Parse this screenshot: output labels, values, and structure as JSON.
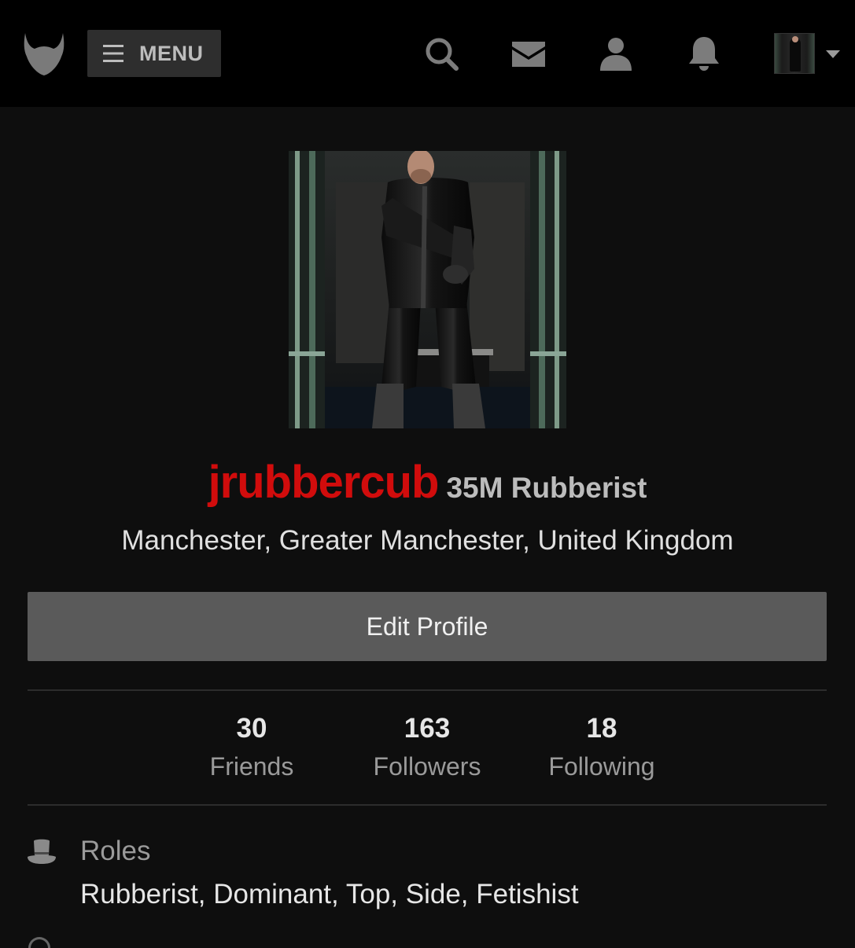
{
  "header": {
    "logo_icon": "devil-head-logo-icon",
    "menu_label": "MENU",
    "menu_icon": "hamburger-icon",
    "nav_icons": [
      "search-icon",
      "mail-icon",
      "user-icon",
      "bell-icon"
    ],
    "account_icon": "caret-down-icon"
  },
  "profile": {
    "username": "jrubbercub",
    "subtitle": "35M Rubberist",
    "location": "Manchester, Greater Manchester, United Kingdom",
    "edit_label": "Edit Profile"
  },
  "stats": [
    {
      "value": "30",
      "label": "Friends"
    },
    {
      "value": "163",
      "label": "Followers"
    },
    {
      "value": "18",
      "label": "Following"
    }
  ],
  "roles": {
    "icon": "top-hat-icon",
    "heading": "Roles",
    "value": "Rubberist, Dominant, Top, Side, Fetishist"
  },
  "colors": {
    "username": "#d10c0c",
    "header_bg": "#000000",
    "page_bg": "#0e0e0e",
    "button_bg": "#5a5a5a"
  }
}
